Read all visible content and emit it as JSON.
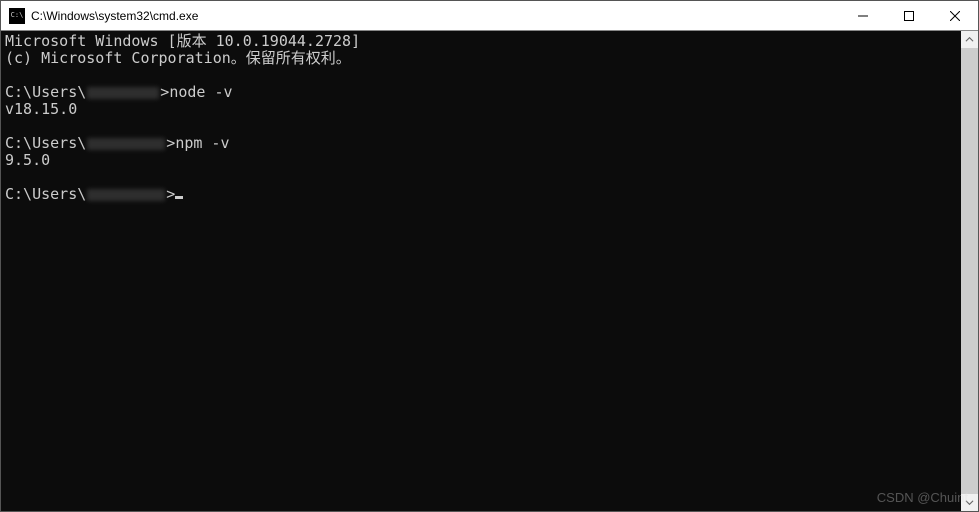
{
  "window": {
    "title": "C:\\Windows\\system32\\cmd.exe"
  },
  "terminal": {
    "banner_line1": "Microsoft Windows [版本 10.0.19044.2728]",
    "banner_line2": "(c) Microsoft Corporation。保留所有权利。",
    "prompt_prefix": "C:\\Users\\",
    "prompt_suffix": ">",
    "cmd1": "node -v",
    "out1": "v18.15.0",
    "cmd2": "npm -v",
    "out2": "9.5.0"
  },
  "watermark": "CSDN @Chuinf"
}
